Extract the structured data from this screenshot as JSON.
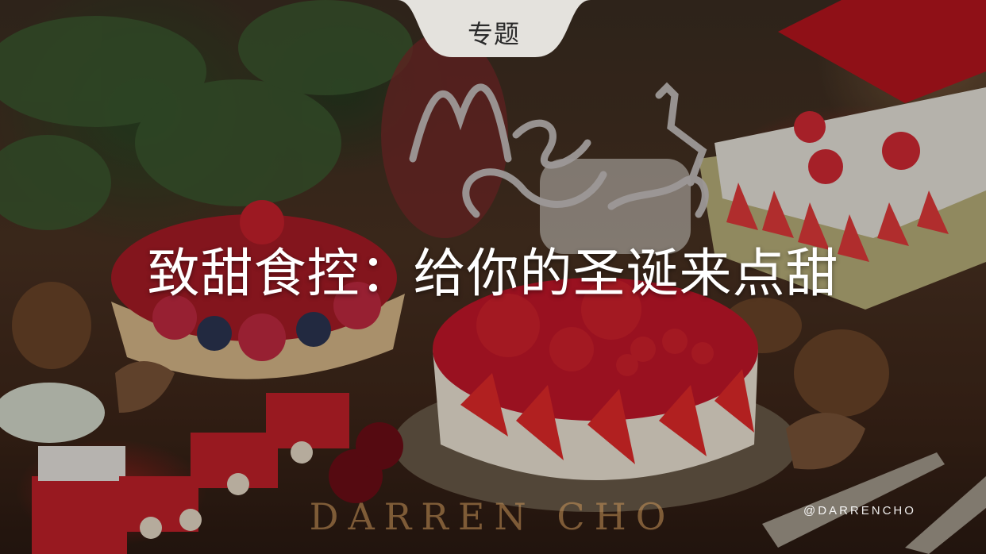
{
  "banner": {
    "tag_label": "专题",
    "headline": "致甜食控：给你的圣诞来点甜",
    "watermark_wordmark": "DARREN CHO",
    "watermark_handle": "@DARRENCHO",
    "topper_text": "Merry Christmas",
    "tag_color": "#e4e2dd",
    "accent_color": "#d42a34"
  }
}
